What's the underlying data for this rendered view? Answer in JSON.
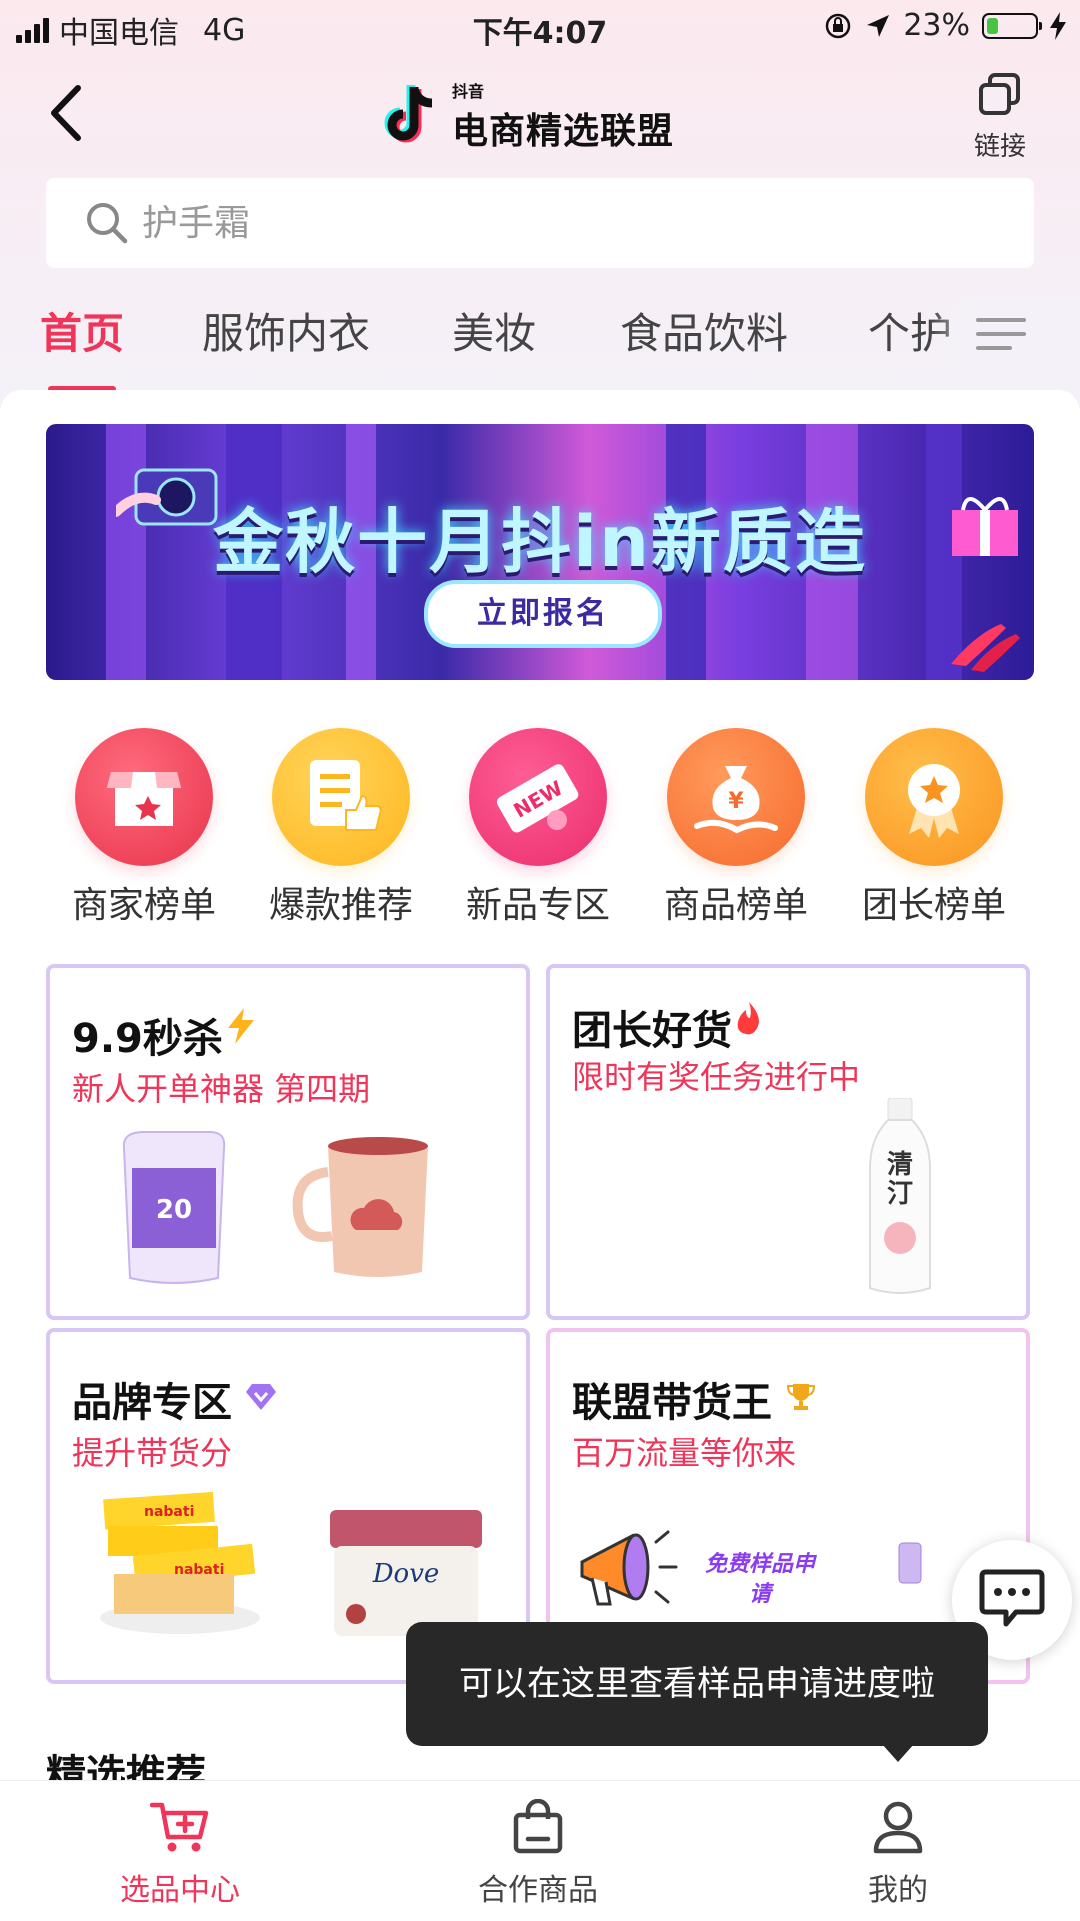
{
  "status_bar": {
    "carrier": "中国电信",
    "network": "4G",
    "time": "下午4:07",
    "battery": "23%",
    "battery_level": 0.23
  },
  "header": {
    "logo_sub": "抖音",
    "logo_main": "电商精选联盟",
    "link_label": "链接"
  },
  "search": {
    "placeholder": "护手霜"
  },
  "tabs": [
    "首页",
    "服饰内衣",
    "美妆",
    "食品饮料",
    "个护"
  ],
  "banner": {
    "title": "金秋十月抖in新质造",
    "button": "立即报名"
  },
  "quick_entries": [
    {
      "label": "商家榜单",
      "icon": "store-icon",
      "color": "#f04a5e"
    },
    {
      "label": "爆款推荐",
      "icon": "thumbs-up-list-icon",
      "color": "#ffc23a"
    },
    {
      "label": "新品专区",
      "icon": "new-tag-icon",
      "color": "#f4397a"
    },
    {
      "label": "商品榜单",
      "icon": "money-bag-icon",
      "color": "#fb7a3c"
    },
    {
      "label": "团长榜单",
      "icon": "medal-icon",
      "color": "#ffa42d"
    }
  ],
  "cards": [
    {
      "title": "9.9秒杀",
      "subtitle": "新人开单神器 第四期",
      "badge": "lightning-icon"
    },
    {
      "title": "团长好货",
      "subtitle": "限时有奖任务进行中",
      "badge": "flame-icon"
    },
    {
      "title": "品牌专区",
      "subtitle": "提升带货分",
      "badge": "diamond-icon"
    },
    {
      "title": "联盟带货王",
      "subtitle": "百万流量等你来",
      "badge": "trophy-icon",
      "promo": "免费样品申请"
    }
  ],
  "tooltip": "可以在这里查看样品申请进度啦",
  "section_title": "精选推荐",
  "bottom_nav": [
    {
      "label": "选品中心",
      "active": true
    },
    {
      "label": "合作商品",
      "active": false
    },
    {
      "label": "我的",
      "active": false
    }
  ],
  "colors": {
    "accent": "#f0355a",
    "card_border": "#d8c6f4"
  }
}
